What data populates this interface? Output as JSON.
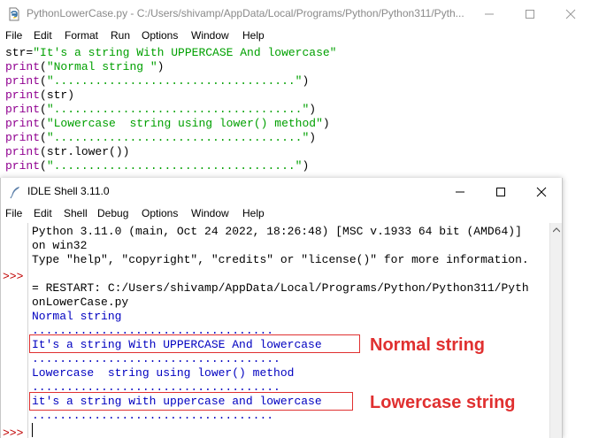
{
  "editor": {
    "title": "PythonLowerCase.py - C:/Users/shivamp/AppData/Local/Programs/Python/Python311/Pyth...",
    "menu": [
      "File",
      "Edit",
      "Format",
      "Run",
      "Options",
      "Window",
      "Help"
    ],
    "code": [
      [
        {
          "t": "str=",
          "c": "plain"
        },
        {
          "t": "\"It's a string With UPPERCASE And lowercase\"",
          "c": "str"
        }
      ],
      [
        {
          "t": "print",
          "c": "kw"
        },
        {
          "t": "(",
          "c": "plain"
        },
        {
          "t": "\"Normal string \"",
          "c": "str"
        },
        {
          "t": ")",
          "c": "plain"
        }
      ],
      [
        {
          "t": "print",
          "c": "kw"
        },
        {
          "t": "(",
          "c": "plain"
        },
        {
          "t": "\"...................................\"",
          "c": "str"
        },
        {
          "t": ")",
          "c": "plain"
        }
      ],
      [
        {
          "t": "print",
          "c": "kw"
        },
        {
          "t": "(str)",
          "c": "plain"
        }
      ],
      [
        {
          "t": "print",
          "c": "kw"
        },
        {
          "t": "(",
          "c": "plain"
        },
        {
          "t": "\"....................................\"",
          "c": "str"
        },
        {
          "t": ")",
          "c": "plain"
        }
      ],
      [
        {
          "t": "print",
          "c": "kw"
        },
        {
          "t": "(",
          "c": "plain"
        },
        {
          "t": "\"Lowercase  string using lower() method\"",
          "c": "str"
        },
        {
          "t": ")",
          "c": "plain"
        }
      ],
      [
        {
          "t": "print",
          "c": "kw"
        },
        {
          "t": "(",
          "c": "plain"
        },
        {
          "t": "\"....................................\"",
          "c": "str"
        },
        {
          "t": ")",
          "c": "plain"
        }
      ],
      [
        {
          "t": "print",
          "c": "kw"
        },
        {
          "t": "(str.lower())",
          "c": "plain"
        }
      ],
      [
        {
          "t": "print",
          "c": "kw"
        },
        {
          "t": "(",
          "c": "plain"
        },
        {
          "t": "\"...................................\"",
          "c": "str"
        },
        {
          "t": ")",
          "c": "plain"
        }
      ]
    ]
  },
  "shell": {
    "title": "IDLE Shell 3.11.0",
    "menu": [
      "File",
      "Edit",
      "Shell",
      "Debug",
      "Options",
      "Window",
      "Help"
    ],
    "prompt_1": ">>>",
    "prompt_2": ">>>",
    "lines": {
      "l1": "Python 3.11.0 (main, Oct 24 2022, 18:26:48) [MSC v.1933 64 bit (AMD64)]",
      "l2": "on win32",
      "l3": "Type \"help\", \"copyright\", \"credits\" or \"license()\" for more information.",
      "l4": "= RESTART: C:/Users/shivamp/AppData/Local/Programs/Python/Python311/Pyth",
      "l5": "onLowerCase.py",
      "l6": "Normal string",
      "l7": "...................................",
      "l8": "It's a string With UPPERCASE And lowercase",
      "l9": "....................................",
      "l10": "Lowercase  string using lower() method",
      "l11": "....................................",
      "l12": "it's a string with uppercase and lowercase",
      "l13": "..................................."
    }
  },
  "annotations": {
    "normal": "Normal string",
    "lower": "Lowercase string"
  },
  "colors": {
    "keyword": "#900090",
    "string": "#00a000",
    "output": "#0000c0",
    "prompt": "#c00000",
    "annotation": "#e03030"
  }
}
